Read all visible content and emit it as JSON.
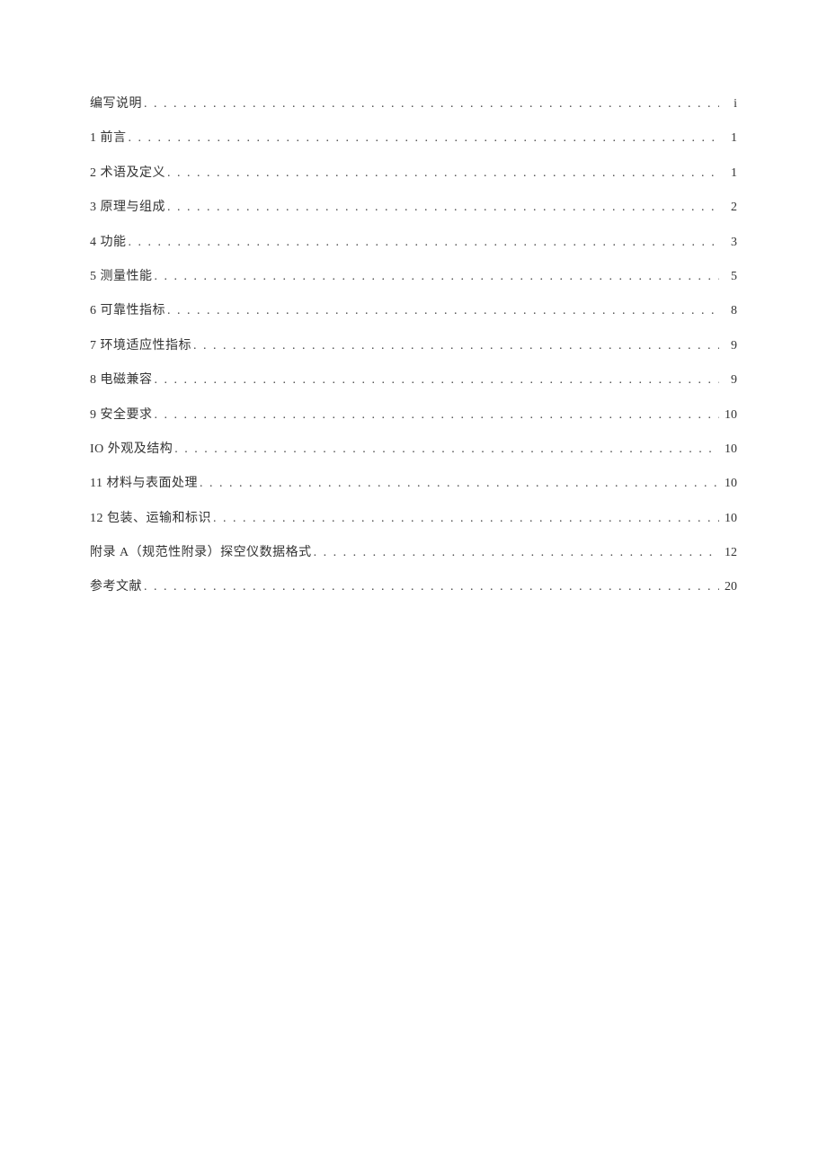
{
  "toc": {
    "entries": [
      {
        "title": "编写说明",
        "page": "i"
      },
      {
        "title": "1 前言",
        "page": "1"
      },
      {
        "title": "2 术语及定义",
        "page": "1"
      },
      {
        "title": "3 原理与组成",
        "page": "2"
      },
      {
        "title": "4 功能",
        "page": "3"
      },
      {
        "title": "5 测量性能",
        "page": "5"
      },
      {
        "title": "6 可靠性指标",
        "page": "8"
      },
      {
        "title": "7 环境适应性指标",
        "page": "9"
      },
      {
        "title": "8 电磁兼容",
        "page": "9"
      },
      {
        "title": "9 安全要求",
        "page": "10"
      },
      {
        "title": "IO 外观及结构",
        "page": "10"
      },
      {
        "title": "11 材料与表面处理",
        "page": "10"
      },
      {
        "title": "12 包装、运输和标识",
        "page": "10"
      },
      {
        "title": "附录 A（规范性附录）探空仪数据格式",
        "page": "12"
      },
      {
        "title": "参考文献",
        "page": "20"
      }
    ]
  }
}
